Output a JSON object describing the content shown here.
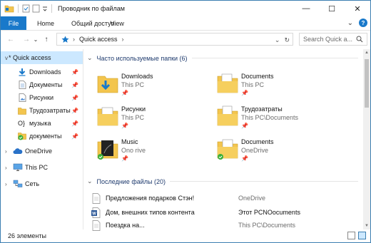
{
  "window": {
    "title": "Проводник по файлам",
    "controls": {
      "minimize": "—",
      "maximize": "☐",
      "close": "✕"
    }
  },
  "ribbon": {
    "tabs": [
      "File",
      "Home",
      "Общий доступ",
      "View"
    ],
    "expand": "⌄",
    "help": "?"
  },
  "address": {
    "back": "←",
    "forward": "→",
    "recent": "⌄",
    "up": "↑",
    "path": "Quick access",
    "separator": "›",
    "dropdown": "⌄",
    "refresh": "↻",
    "search_placeholder": "Search Quick a...",
    "search_icon": "search-icon"
  },
  "nav": {
    "quick_access": {
      "label": "Quick access",
      "chevron": "v",
      "star": "*"
    },
    "pinned": [
      {
        "label": "Downloads",
        "icon": "download-arrow-icon",
        "pin": "📌"
      },
      {
        "label": "Документы",
        "icon": "document-icon",
        "pin": "📌"
      },
      {
        "label": "Рисунки",
        "icon": "pictures-icon",
        "pin": "📌"
      },
      {
        "label": "Трудозатраты",
        "icon": "folder-icon",
        "pin": "📌"
      },
      {
        "label": "музыка",
        "prefix": "O}",
        "icon": "music-icon",
        "pin": "📌"
      },
      {
        "label": "документы",
        "icon": "synced-folder-icon",
        "pin": "📌"
      }
    ],
    "roots": [
      {
        "label": "OneDrive",
        "icon": "onedrive-cloud-icon"
      },
      {
        "label": "This PC",
        "icon": "computer-icon"
      },
      {
        "label": "Сеть",
        "icon": "network-icon"
      }
    ]
  },
  "content": {
    "frequent_header": "Часто используемые папки (6)",
    "frequent": [
      {
        "name": "Downloads",
        "location": "This PC",
        "icon": "downloads-folder-icon"
      },
      {
        "name": "Documents",
        "location": "This PC",
        "icon": "documents-folder-icon"
      },
      {
        "name": "Рисунки",
        "location": "This PC",
        "icon": "pictures-folder-icon"
      },
      {
        "name": "Трудозатраты",
        "location": "This PC\\Documents",
        "icon": "documents-folder-icon"
      },
      {
        "name": "Music",
        "location": "Ono rive",
        "icon": "music-folder-icon"
      },
      {
        "name": "Documents",
        "location": "OneDrive",
        "icon": "onedrive-folder-icon"
      }
    ],
    "recent_header": "Последние файлы (20)",
    "recent": [
      {
        "name": "Предложения подарков Стэн!",
        "location": "OneDrive",
        "icon": "text-file-icon"
      },
      {
        "name": "Дом, внешних типов контента",
        "location": "Этот PCNOocuments",
        "icon": "word-file-icon"
      },
      {
        "name": "Поездка на...",
        "location": "This PC\\Documents",
        "icon": "text-file-icon"
      }
    ],
    "pin_glyph": "📌"
  },
  "status": {
    "text": "26 элементы"
  },
  "colors": {
    "accent": "#1979ca",
    "selection": "#cce8ff",
    "folder": "#f3c54e",
    "onedrive": "#2a72c8",
    "check": "#3bb03a"
  }
}
